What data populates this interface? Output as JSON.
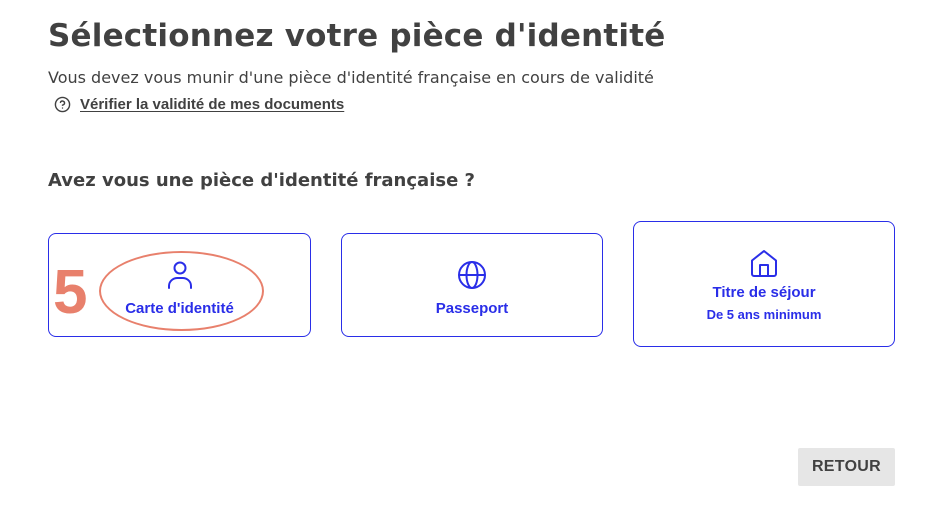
{
  "header": {
    "title": "Sélectionnez votre pièce d'identité",
    "subtitle": "Vous devez vous munir d'une pièce d'identité française en cours de validité",
    "help_link": {
      "icon": "question-circle-icon",
      "label": "Vérifier la validité de mes documents"
    }
  },
  "question": "Avez vous une pièce d'identité française ?",
  "options": [
    {
      "icon": "person-icon",
      "label": "Carte d'identité"
    },
    {
      "icon": "globe-icon",
      "label": "Passeport"
    },
    {
      "icon": "home-icon",
      "label": "Titre de séjour",
      "sublabel": "De 5 ans minimum"
    }
  ],
  "annotation": {
    "step_number": "5",
    "color": "#e8806c"
  },
  "footer": {
    "back_label": "RETOUR"
  },
  "colors": {
    "accent": "#2a2ee8",
    "text": "#414141",
    "button_bg": "#e6e6e6"
  }
}
